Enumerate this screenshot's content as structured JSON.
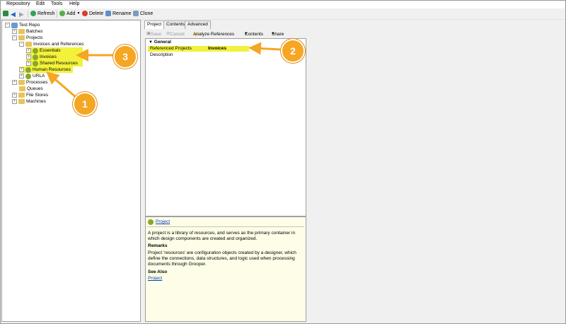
{
  "menu": [
    "Repository",
    "Edit",
    "Tools",
    "Help"
  ],
  "toolbar": {
    "refresh": "Refresh",
    "add": "Add",
    "delete": "Delete",
    "rename": "Rename",
    "clone": "Clone"
  },
  "tree": {
    "root": "Test Repo",
    "batches": "Batches",
    "projects": "Projects",
    "invoices_and_references": "Invoices and References",
    "essentials": "Essentials",
    "invoices": "Invoices",
    "shared_resources": "Shared Resources",
    "human_resources": "Human Resources",
    "urla": "URLA",
    "processes": "Processes",
    "queues": "Queues",
    "file_stores": "File Stores",
    "machines": "Machines"
  },
  "tabs": [
    "Project",
    "Contents",
    "Advanced"
  ],
  "right_toolbar": {
    "save": "Save",
    "cancel": "Cancel",
    "analyze": "Analyze References",
    "contents": "Contents",
    "share": "Share"
  },
  "properties": {
    "group": "General",
    "ref_label": "Referenced Projects",
    "ref_value": "Invoices",
    "description_label": "Description"
  },
  "help": {
    "title": "Project",
    "body": "A project is a library of resources, and serves as the primary container in which design components are created and organized.",
    "remarks_title": "Remarks",
    "remarks": "Project 'resources' are configuration objects created by a designer, which define the connections, data structures, and logic used when processing documents through Grooper.",
    "see_also_title": "See Also",
    "see_also_link": "Project"
  },
  "callouts": [
    "1",
    "2",
    "3"
  ],
  "colors": {
    "highlight": "#f2f23c",
    "callout": "#f5a623"
  }
}
